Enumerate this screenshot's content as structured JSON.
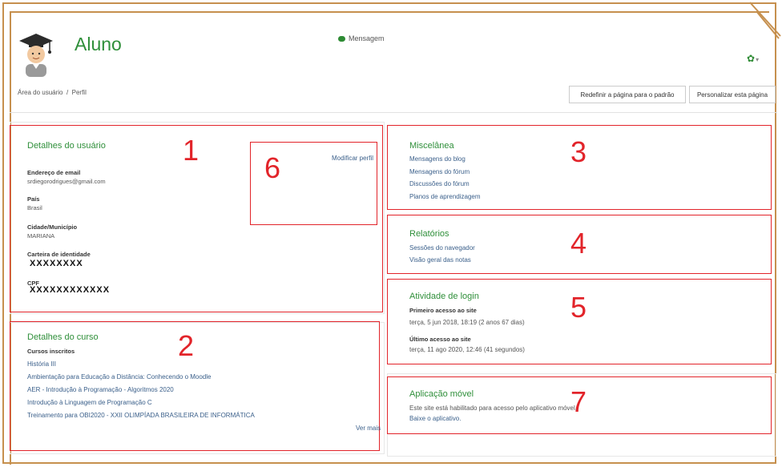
{
  "header": {
    "title": "Aluno",
    "message_label": "Mensagem",
    "gear_caret": "▾"
  },
  "breadcrumb": {
    "items": [
      "Área do usuário",
      "/",
      "Perfil"
    ]
  },
  "actions": {
    "reset_label": "Redefinir a página para o padrão",
    "customize_label": "Personalizar esta página"
  },
  "annotations": {
    "n1": "1",
    "n2": "2",
    "n3": "3",
    "n4": "4",
    "n5": "5",
    "n6": "6",
    "n7": "7"
  },
  "user_details": {
    "heading": "Detalhes do usuário",
    "edit_link": "Modificar perfil",
    "email_label": "Endereço de email",
    "email_value": "srdiegorodrigues@gmail.com",
    "country_label": "País",
    "country_value": "Brasil",
    "city_label": "Cidade/Município",
    "city_value": "MARIANA",
    "id_label": "Carteira de identidade",
    "id_value": "XXXXXXXX",
    "cpf_label": "CPF",
    "cpf_value": "XXXXXXXXXXXX"
  },
  "course_details": {
    "heading": "Detalhes do curso",
    "enrolled_label": "Cursos inscritos",
    "courses": [
      "História III",
      "Ambientação para Educação a Distância: Conhecendo o Moodle",
      "AER - Introdução à Programação - Algoritmos 2020",
      "Introdução à Linguagem de Programação C",
      "Treinamento para OBI2020 - XXII OLIMPÍADA BRASILEIRA DE INFORMÁTICA"
    ],
    "see_more": "Ver mais"
  },
  "misc": {
    "heading": "Miscelânea",
    "links": [
      "Mensagens do blog",
      "Mensagens do fórum",
      "Discussões do fórum",
      "Planos de aprendizagem"
    ]
  },
  "reports": {
    "heading": "Relatórios",
    "links": [
      "Sessões do navegador",
      "Visão geral das notas"
    ]
  },
  "login_activity": {
    "heading": "Atividade de login",
    "first_label": "Primeiro acesso ao site",
    "first_value": "terça, 5 jun 2018, 18:19  (2 anos 67 dias)",
    "last_label": "Último acesso ao site",
    "last_value": "terça, 11 ago 2020, 12:46  (41 segundos)"
  },
  "mobile_app": {
    "heading": "Aplicação móvel",
    "line1": "Este site está habilitado para acesso pelo aplicativo móvel.",
    "link": "Baixe o aplicativo."
  },
  "colors": {
    "accent_green": "#2f8f3a",
    "annotation_red": "#e2242a",
    "frame_gold": "#c6904e",
    "link_blue": "#3a5f8a"
  }
}
